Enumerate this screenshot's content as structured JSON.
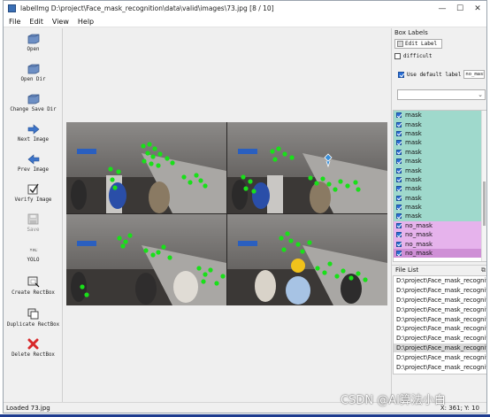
{
  "window": {
    "title": "labelImg D:\\project\\Face_mask_recognition\\data\\valid\\images\\73.jpg [8 / 10]",
    "controls": {
      "minimize": "—",
      "maximize": "☐",
      "close": "✕"
    }
  },
  "menu": [
    "File",
    "Edit",
    "View",
    "Help"
  ],
  "toolbar": [
    {
      "key": "open",
      "label": "Open",
      "icon": "folder-icon",
      "enabled": true
    },
    {
      "key": "open-dir",
      "label": "Open Dir",
      "icon": "folder-icon",
      "enabled": true
    },
    {
      "key": "change-save-dir",
      "label": "Change Save Dir",
      "icon": "folder-icon",
      "enabled": true
    },
    {
      "key": "next-image",
      "label": "Next Image",
      "icon": "arrow-right-icon",
      "enabled": true
    },
    {
      "key": "prev-image",
      "label": "Prev Image",
      "icon": "arrow-left-icon",
      "enabled": true
    },
    {
      "key": "verify-image",
      "label": "Verify Image",
      "icon": "checkbox-icon",
      "enabled": true
    },
    {
      "key": "save",
      "label": "Save",
      "icon": "save-icon",
      "enabled": false
    },
    {
      "key": "format",
      "label": "YOLO",
      "icon": "yolo-format-icon",
      "enabled": true
    },
    {
      "key": "create-rectbox",
      "label": "Create RectBox",
      "icon": "rectbox-icon",
      "enabled": true
    },
    {
      "key": "duplicate-rectbox",
      "label": "Duplicate RectBox",
      "icon": "duplicate-icon",
      "enabled": true
    },
    {
      "key": "delete-rectbox",
      "label": "Delete RectBox",
      "icon": "delete-icon",
      "enabled": true
    }
  ],
  "box_labels": {
    "title": "Box Labels",
    "edit_label": "Edit Label",
    "difficult": "difficult",
    "use_default_label": "Use default label",
    "default_label_value": "no_mask",
    "combo_value": "",
    "items": [
      {
        "label": "mask",
        "checked": true,
        "color": "#9fd9cc"
      },
      {
        "label": "mask",
        "checked": true,
        "color": "#9fd9cc"
      },
      {
        "label": "mask",
        "checked": true,
        "color": "#9fd9cc"
      },
      {
        "label": "mask",
        "checked": true,
        "color": "#9fd9cc"
      },
      {
        "label": "mask",
        "checked": true,
        "color": "#9fd9cc"
      },
      {
        "label": "mask",
        "checked": true,
        "color": "#9fd9cc"
      },
      {
        "label": "mask",
        "checked": true,
        "color": "#9fd9cc"
      },
      {
        "label": "mask",
        "checked": true,
        "color": "#9fd9cc"
      },
      {
        "label": "mask",
        "checked": true,
        "color": "#9fd9cc"
      },
      {
        "label": "mask",
        "checked": true,
        "color": "#9fd9cc"
      },
      {
        "label": "mask",
        "checked": true,
        "color": "#9fd9cc"
      },
      {
        "label": "mask",
        "checked": true,
        "color": "#9fd9cc"
      },
      {
        "label": "no_mask",
        "checked": true,
        "color": "#e6b3ec"
      },
      {
        "label": "no_mask",
        "checked": true,
        "color": "#e6b3ec"
      },
      {
        "label": "no_mask",
        "checked": true,
        "color": "#e6b3ec"
      },
      {
        "label": "no_mask",
        "checked": true,
        "color": "#cf8fd6"
      }
    ]
  },
  "file_list": {
    "title": "File List",
    "selected_index": 7,
    "items": [
      "D:\\project\\Face_mask_recognition",
      "D:\\project\\Face_mask_recognition",
      "D:\\project\\Face_mask_recognition",
      "D:\\project\\Face_mask_recognition",
      "D:\\project\\Face_mask_recognition",
      "D:\\project\\Face_mask_recognition",
      "D:\\project\\Face_mask_recognition",
      "D:\\project\\Face_mask_recognition",
      "D:\\project\\Face_mask_recognition",
      "D:\\project\\Face_mask_recognition"
    ]
  },
  "status": {
    "text": "Loaded 73.jpg",
    "coords": "X: 361; Y: 10"
  },
  "watermark": "CSDN @AI算法小白",
  "colors": {
    "point_green": "#19e019",
    "selected_point": "#3a8fd8",
    "mask_row": "#9fd9cc",
    "no_mask_row": "#e6b3ec"
  }
}
